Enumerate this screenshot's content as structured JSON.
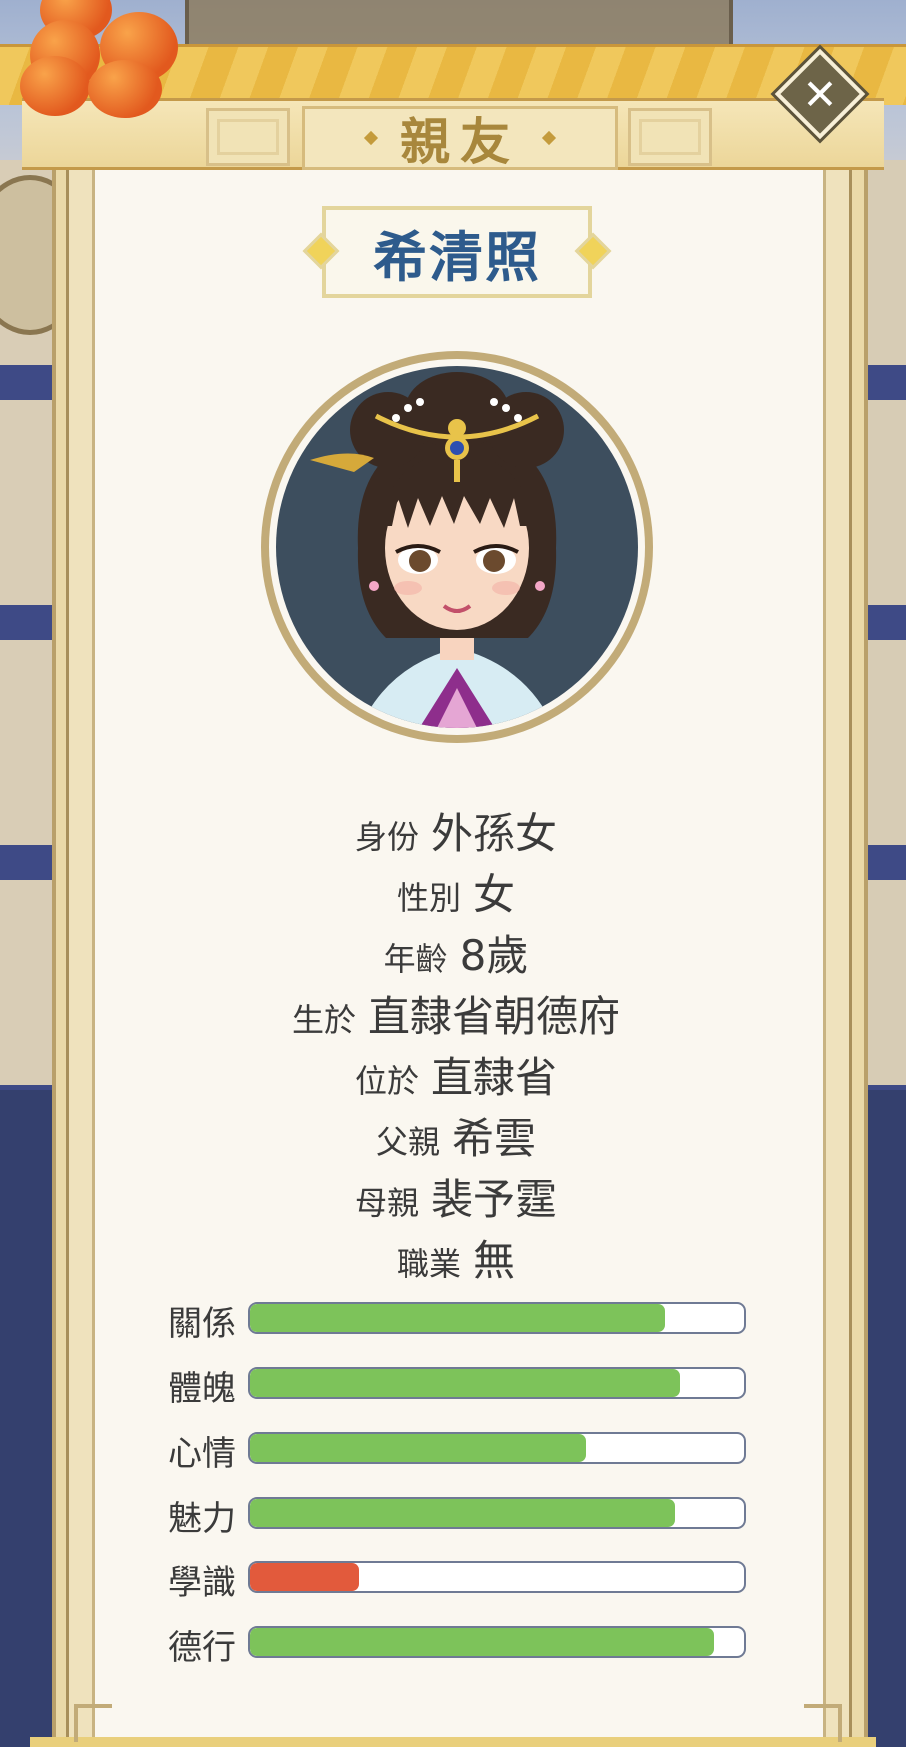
{
  "header": {
    "title": "親友",
    "close_label": "✕"
  },
  "person": {
    "name": "希清照",
    "info": [
      {
        "label": "身份",
        "value": "外孫女"
      },
      {
        "label": "性別",
        "value": "女"
      },
      {
        "label": "年齡",
        "value": "8歲"
      },
      {
        "label": "生於",
        "value": "直隸省朝德府"
      },
      {
        "label": "位於",
        "value": "直隸省"
      },
      {
        "label": "父親",
        "value": "希雲"
      },
      {
        "label": "母親",
        "value": "裴予霆"
      },
      {
        "label": "職業",
        "value": "無"
      }
    ],
    "stats": [
      {
        "label": "關係",
        "level": 0.84,
        "color": "#7dc35a"
      },
      {
        "label": "體魄",
        "level": 0.87,
        "color": "#7dc35a"
      },
      {
        "label": "心情",
        "level": 0.68,
        "color": "#7dc35a"
      },
      {
        "label": "魅力",
        "level": 0.86,
        "color": "#7dc35a"
      },
      {
        "label": "學識",
        "level": 0.22,
        "color": "#e25a3c"
      },
      {
        "label": "德行",
        "level": 0.94,
        "color": "#7dc35a"
      }
    ]
  },
  "colors": {
    "accent": "#2e5b8c",
    "gold": "#a8873c",
    "panel": "#faf7f0"
  }
}
